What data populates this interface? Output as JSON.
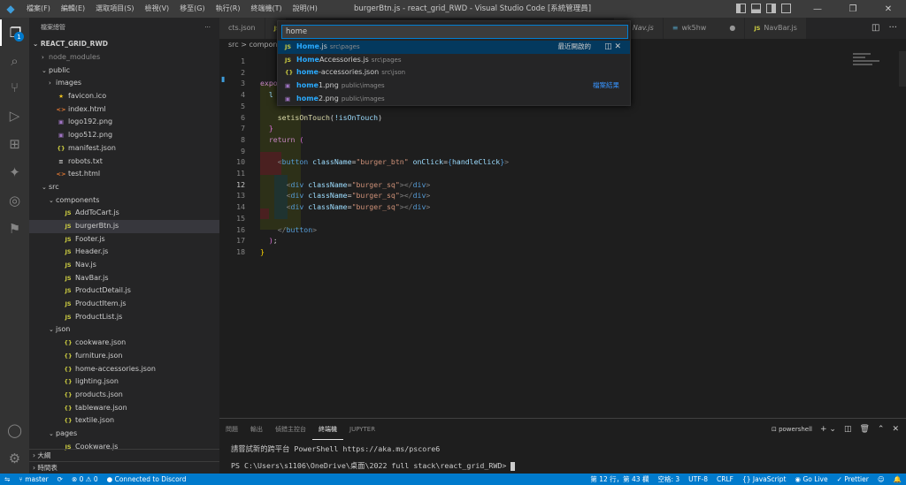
{
  "titlebar": {
    "menu": [
      "檔案(F)",
      "編輯(E)",
      "選取項目(S)",
      "檢視(V)",
      "移至(G)",
      "執行(R)",
      "終端機(T)",
      "說明(H)"
    ],
    "title": "burgerBtn.js - react_grid_RWD - Visual Studio Code [系統管理員]"
  },
  "sidebar": {
    "header": "檔案總管",
    "root": "REACT_GRID_RWD",
    "tree": [
      {
        "label": "node_modules",
        "depth": 1,
        "type": "folder-closed",
        "dim": true
      },
      {
        "label": "public",
        "depth": 1,
        "type": "folder-open"
      },
      {
        "label": "images",
        "depth": 2,
        "type": "folder-closed"
      },
      {
        "label": "favicon.ico",
        "depth": 2,
        "type": "star"
      },
      {
        "label": "index.html",
        "depth": 2,
        "type": "html"
      },
      {
        "label": "logo192.png",
        "depth": 2,
        "type": "img"
      },
      {
        "label": "logo512.png",
        "depth": 2,
        "type": "img"
      },
      {
        "label": "manifest.json",
        "depth": 2,
        "type": "json"
      },
      {
        "label": "robots.txt",
        "depth": 2,
        "type": "txt"
      },
      {
        "label": "test.html",
        "depth": 2,
        "type": "html"
      },
      {
        "label": "src",
        "depth": 1,
        "type": "folder-open"
      },
      {
        "label": "components",
        "depth": 2,
        "type": "folder-open"
      },
      {
        "label": "AddToCart.js",
        "depth": 3,
        "type": "js"
      },
      {
        "label": "burgerBtn.js",
        "depth": 3,
        "type": "js",
        "selected": true
      },
      {
        "label": "Footer.js",
        "depth": 3,
        "type": "js"
      },
      {
        "label": "Header.js",
        "depth": 3,
        "type": "js"
      },
      {
        "label": "Nav.js",
        "depth": 3,
        "type": "js"
      },
      {
        "label": "NavBar.js",
        "depth": 3,
        "type": "js"
      },
      {
        "label": "ProductDetail.js",
        "depth": 3,
        "type": "js"
      },
      {
        "label": "ProductItem.js",
        "depth": 3,
        "type": "js"
      },
      {
        "label": "ProductList.js",
        "depth": 3,
        "type": "js"
      },
      {
        "label": "json",
        "depth": 2,
        "type": "folder-open"
      },
      {
        "label": "cookware.json",
        "depth": 3,
        "type": "json"
      },
      {
        "label": "furniture.json",
        "depth": 3,
        "type": "json"
      },
      {
        "label": "home-accessories.json",
        "depth": 3,
        "type": "json"
      },
      {
        "label": "lighting.json",
        "depth": 3,
        "type": "json"
      },
      {
        "label": "products.json",
        "depth": 3,
        "type": "json"
      },
      {
        "label": "tableware.json",
        "depth": 3,
        "type": "json"
      },
      {
        "label": "textile.json",
        "depth": 3,
        "type": "json"
      },
      {
        "label": "pages",
        "depth": 2,
        "type": "folder-open"
      },
      {
        "label": "Cookware.js",
        "depth": 3,
        "type": "js"
      }
    ],
    "outline": "大綱",
    "timeline": "時間表"
  },
  "icons": {
    "js": "JS",
    "json": "{}",
    "html": "<>",
    "img": "▣",
    "star": "★",
    "txt": "≡"
  },
  "tabs": [
    {
      "label": "cts.json",
      "icon": ""
    },
    {
      "label": "JS",
      "icon": ""
    },
    {
      "label": "Nav.js",
      "icon": "JS"
    },
    {
      "label": "wk5hw",
      "icon": ""
    },
    {
      "label": "NavBar.js",
      "icon": "JS"
    }
  ],
  "breadcrumb": "src > compon",
  "quickopen": {
    "query": "home",
    "recent_label": "最近開啟的",
    "results_label": "檔案結果",
    "items": [
      {
        "icon": "JS",
        "hl": "Home",
        "rest": ".js",
        "path": "src\\pages",
        "selected": true
      },
      {
        "icon": "JS",
        "hl": "Home",
        "rest": "Accessories.js",
        "path": "src\\pages"
      },
      {
        "icon": "{}",
        "hl": "home",
        "rest": "-accessories.json",
        "path": "src\\json"
      },
      {
        "icon": "▣",
        "hl": "home",
        "rest": "1.png",
        "path": "public\\images"
      },
      {
        "icon": "▣",
        "hl": "home",
        "rest": "2.png",
        "path": "public\\images"
      }
    ]
  },
  "editor": {
    "lines": [
      {
        "n": "1",
        "html": ""
      },
      {
        "n": "2",
        "html": ""
      },
      {
        "n": "3",
        "html": "<span class='kw'>expo</span>"
      },
      {
        "n": "4",
        "html": "  <span class='var'>l</span>"
      },
      {
        "n": "5",
        "html": ""
      },
      {
        "n": "6",
        "html": "    <span class='fn'>setisOnTouch</span>(<span class='var'>!isOnTouch</span>)"
      },
      {
        "n": "7",
        "html": "  <span class='brace'>}</span>"
      },
      {
        "n": "8",
        "html": "  <span class='kw'>return</span> <span class='brace'>(</span>"
      },
      {
        "n": "9",
        "html": ""
      },
      {
        "n": "10",
        "html": "    <span class='ang'>&lt;</span><span class='tag'>button</span> <span class='attr'>className</span>=<span class='str'>\"burger_btn\"</span> <span class='attr'>onClick</span>=<span class='kw2'>{</span><span class='var'>handleClick</span><span class='kw2'>}</span><span class='ang'>&gt;</span>"
      },
      {
        "n": "11",
        "html": ""
      },
      {
        "n": "12",
        "html": "      <span class='ang'>&lt;</span><span class='tag'>div</span> <span class='attr'>className</span>=<span class='str'>\"burger_sq\"</span><span class='ang'>&gt;&lt;/</span><span class='tag'>div</span><span class='ang'>&gt;</span>",
        "current": true
      },
      {
        "n": "13",
        "html": "      <span class='ang'>&lt;</span><span class='tag'>div</span> <span class='attr'>className</span>=<span class='str'>\"burger_sq\"</span><span class='ang'>&gt;&lt;/</span><span class='tag'>div</span><span class='ang'>&gt;</span>"
      },
      {
        "n": "14",
        "html": "      <span class='ang'>&lt;</span><span class='tag'>div</span> <span class='attr'>className</span>=<span class='str'>\"burger_sq\"</span><span class='ang'>&gt;&lt;/</span><span class='tag'>div</span><span class='ang'>&gt;</span>"
      },
      {
        "n": "15",
        "html": ""
      },
      {
        "n": "16",
        "html": "    <span class='ang'>&lt;/</span><span class='tag'>button</span><span class='ang'>&gt;</span>"
      },
      {
        "n": "17",
        "html": "  <span class='brace'>)</span>;"
      },
      {
        "n": "18",
        "html": "<span class='brace2'>}</span>"
      }
    ]
  },
  "panel": {
    "tabs": [
      "問題",
      "輸出",
      "偵錯主控台",
      "終端機",
      "JUPYTER"
    ],
    "active_tab": "終端機",
    "terminal_name": "powershell",
    "line1": "請嘗試新的跨平台 PowerShell https://aka.ms/pscore6",
    "line2": "PS C:\\Users\\s1106\\OneDrive\\桌面\\2022 full stack\\react_grid_RWD> "
  },
  "status": {
    "branch": "master",
    "sync": "⟳",
    "errors": "0",
    "warnings": "0",
    "discord": "Connected to Discord",
    "position": "第 12 行，第 43 欄",
    "spaces": "空格: 3",
    "encoding": "UTF-8",
    "eol": "CRLF",
    "language": "JavaScript",
    "golive": "Go Live",
    "prettier": "Prettier"
  },
  "colors": {
    "accent": "#007acc",
    "selection": "#04395e",
    "highlight": "#2aaaff"
  }
}
